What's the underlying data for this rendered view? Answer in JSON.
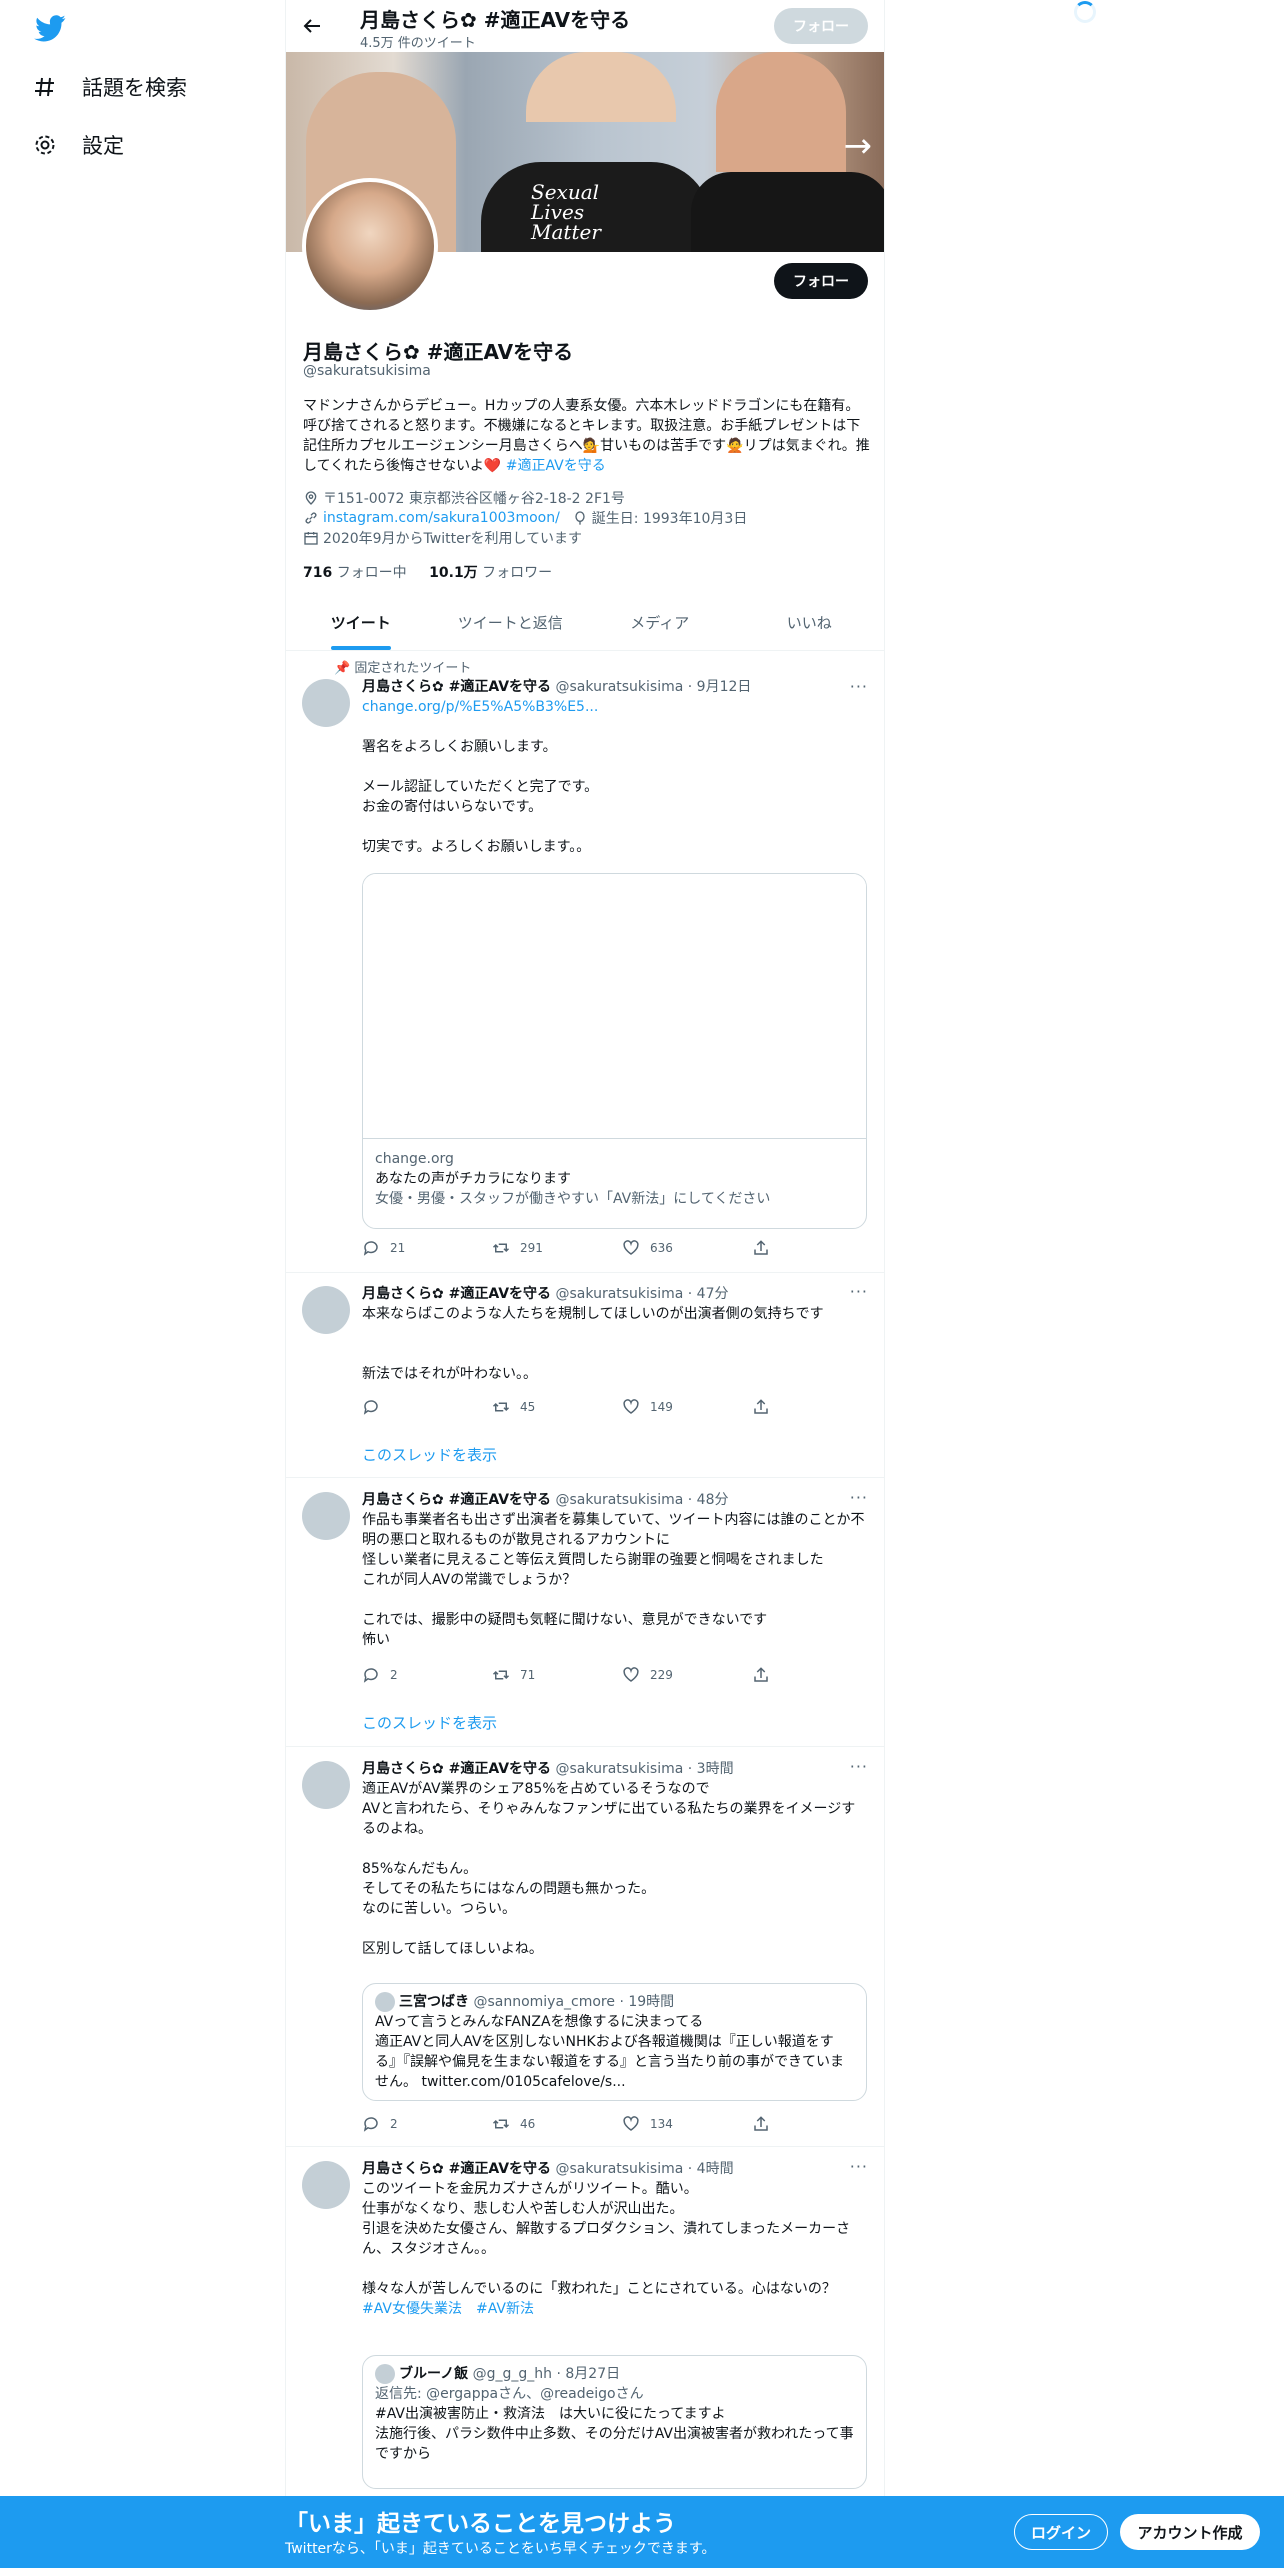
{
  "sidebar": {
    "explore_label": "話題を検索",
    "settings_label": "設定"
  },
  "header": {
    "name": "月島さくら✿ #適正AVを守る",
    "tweet_count": "4.5万 件のツイート",
    "follow_label": "フォロー"
  },
  "profile": {
    "banner_text": "Sexual\nLives\nMatter",
    "follow_label": "フォロー",
    "name": "月島さくら✿ #適正AVを守る",
    "handle": "@sakuratsukisima",
    "bio": "マドンナさんからデビュー。Hカップの人妻系女優。六本木レッドドラゴンにも在籍有。呼び捨てされると怒ります。不機嫌になるとキレます。取扱注意。お手紙プレゼントは下記住所カプセルエージェンシー月島さくらへ💁甘いものは苦手です🙅リプは気まぐれ。推してくれたら後悔させないよ❤️ ",
    "bio_hashtag": "#適正AVを守る",
    "location": "〒151-0072 東京都渋谷区幡ヶ谷2-18-2 2F1号",
    "website": "instagram.com/sakura1003moon/",
    "birthday": "誕生日: 1993年10月3日",
    "joined": "2020年9月からTwitterを利用しています",
    "following_count": "716",
    "following_label": "フォロー中",
    "followers_count": "10.1万",
    "followers_label": "フォロワー"
  },
  "tabs": [
    {
      "label": "ツイート"
    },
    {
      "label": "ツイートと返信"
    },
    {
      "label": "メディア"
    },
    {
      "label": "いいね"
    }
  ],
  "tweets": [
    {
      "pinned_label": "固定されたツイート",
      "name": "月島さくら✿ #適正AVを守る",
      "handle_time": "@sakuratsukisima · 9月12日",
      "link": "change.org/p/%E5%A5%B3%E5...",
      "text": "署名をよろしくお願いします。\n\nメール認証していただくと完了です。\nお金の寄付はいらないです。\n\n切実です。よろしくお願いします。。",
      "card_domain": "change.org",
      "card_title": "あなたの声がチカラになります",
      "card_desc": "女優・男優・スタッフが働きやすい「AV新法」にしてください",
      "replies": "21",
      "retweets": "291",
      "likes": "636"
    },
    {
      "name": "月島さくら✿ #適正AVを守る",
      "handle_time": "@sakuratsukisima · 47分",
      "text": "本来ならばこのような人たちを規制してほしいのが出演者側の気持ちです\n\n\n新法ではそれが叶わない。。",
      "replies": "",
      "retweets": "45",
      "likes": "149",
      "thread_label": "このスレッドを表示"
    },
    {
      "name": "月島さくら✿ #適正AVを守る",
      "handle_time": "@sakuratsukisima · 48分",
      "text": "作品も事業者名も出さず出演者を募集していて、ツイート内容には誰のことか不明の悪口と取れるものが散見されるアカウントに\n怪しい業者に見えること等伝え質問したら謝罪の強要と恫喝をされました\nこれが同人AVの常識でしょうか？\n\nこれでは、撮影中の疑問も気軽に聞けない、意見ができないです\n怖い",
      "replies": "2",
      "retweets": "71",
      "likes": "229",
      "thread_label": "このスレッドを表示"
    },
    {
      "name": "月島さくら✿ #適正AVを守る",
      "handle_time": "@sakuratsukisima · 3時間",
      "text": "適正AVがAV業界のシェア85%を占めているそうなので\nAVと言われたら、そりゃみんなファンザに出ている私たちの業界をイメージするのよね。\n\n85%なんだもん。\nそしてその私たちにはなんの問題も無かった。\nなのに苦しい。つらい。\n\n区別して話してほしいよね。",
      "quote_name": "三宮つばき",
      "quote_handle_time": "@sannomiya_cmore · 19時間",
      "quote_text": "AVって言うとみんなFANZAを想像するに決まってる\n適正AVと同人AVを区別しないNHKおよび各報道機関は『正しい報道をする』『誤解や偏見を生まない報道をする』と言う当たり前の事ができていません。 twitter.com/0105cafelove/s...",
      "replies": "2",
      "retweets": "46",
      "likes": "134"
    },
    {
      "name": "月島さくら✿ #適正AVを守る",
      "handle_time": "@sakuratsukisima · 4時間",
      "text": "このツイートを金尻カズナさんがリツイート。酷い。\n仕事がなくなり、悲しむ人や苦しむ人が沢山出た。\n引退を決めた女優さん、解散するプロダクション、潰れてしまったメーカーさん、スタジオさん。。\n\n様々な人が苦しんでいるのに「救われた」ことにされている。心はないの？",
      "hashtags": "#AV女優失業法　#AV新法",
      "quote_name": "ブルーノ飯",
      "quote_handle_time": "@g_g_g_hh · 8月27日",
      "quote_reply": "返信先: @ergappaさん、@readeigoさん",
      "quote_text": "#AV出演被害防止・救済法　は大いに役にたってますよ\n法施行後、パラシ数件中止多数、その分だけAV出演被害者が救われたって事ですから"
    }
  ],
  "footer": {
    "title": "「いま」起きていることを見つけよう",
    "subtitle": "Twitterなら、「いま」起きていることをいち早くチェックできます。",
    "login_label": "ログイン",
    "signup_label": "アカウント作成"
  },
  "colors": {
    "accent": "#1d9bf0",
    "text": "#0f1419",
    "secondary": "#536471"
  }
}
